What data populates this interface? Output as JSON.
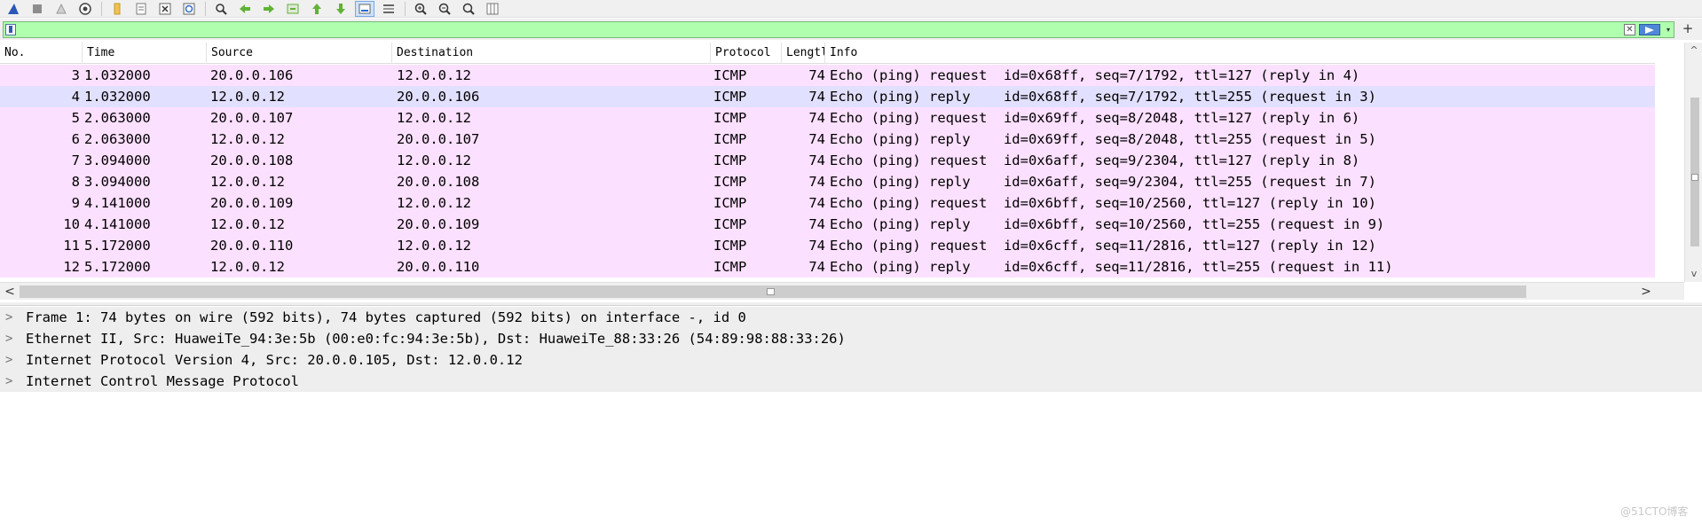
{
  "toolbar": {
    "icons": [
      "shark-fin-start-icon",
      "stop-capture-icon",
      "restart-capture-icon",
      "capture-options-icon",
      "open-file-icon",
      "save-file-icon",
      "close-file-icon",
      "reload-file-icon",
      "find-packet-icon",
      "go-back-icon",
      "go-forward-icon",
      "go-to-packet-icon",
      "first-packet-icon",
      "last-packet-icon",
      "autoscroll-icon",
      "colorize-icon",
      "zoom-in-icon",
      "zoom-out-icon",
      "normal-size-icon",
      "resize-columns-icon"
    ]
  },
  "filter": {
    "value": "",
    "clear_label": "✕",
    "dropdown_label": "▾",
    "add_label": "+",
    "bg_color": "#afffaf"
  },
  "packet_list": {
    "columns": [
      "No.",
      "Time",
      "Source",
      "Destination",
      "Protocol",
      "Lengtl",
      "Info"
    ],
    "rows": [
      {
        "no": "3",
        "time": "1.032000",
        "source": "20.0.0.106",
        "destination": "12.0.0.12",
        "protocol": "ICMP",
        "length": "74",
        "info": "Echo (ping) request  id=0x68ff, seq=7/1792, ttl=127 (reply in 4)"
      },
      {
        "no": "4",
        "time": "1.032000",
        "source": "12.0.0.12",
        "destination": "20.0.0.106",
        "protocol": "ICMP",
        "length": "74",
        "info": "Echo (ping) reply    id=0x68ff, seq=7/1792, ttl=255 (request in 3)"
      },
      {
        "no": "5",
        "time": "2.063000",
        "source": "20.0.0.107",
        "destination": "12.0.0.12",
        "protocol": "ICMP",
        "length": "74",
        "info": "Echo (ping) request  id=0x69ff, seq=8/2048, ttl=127 (reply in 6)"
      },
      {
        "no": "6",
        "time": "2.063000",
        "source": "12.0.0.12",
        "destination": "20.0.0.107",
        "protocol": "ICMP",
        "length": "74",
        "info": "Echo (ping) reply    id=0x69ff, seq=8/2048, ttl=255 (request in 5)"
      },
      {
        "no": "7",
        "time": "3.094000",
        "source": "20.0.0.108",
        "destination": "12.0.0.12",
        "protocol": "ICMP",
        "length": "74",
        "info": "Echo (ping) request  id=0x6aff, seq=9/2304, ttl=127 (reply in 8)"
      },
      {
        "no": "8",
        "time": "3.094000",
        "source": "12.0.0.12",
        "destination": "20.0.0.108",
        "protocol": "ICMP",
        "length": "74",
        "info": "Echo (ping) reply    id=0x6aff, seq=9/2304, ttl=255 (request in 7)"
      },
      {
        "no": "9",
        "time": "4.141000",
        "source": "20.0.0.109",
        "destination": "12.0.0.12",
        "protocol": "ICMP",
        "length": "74",
        "info": "Echo (ping) request  id=0x6bff, seq=10/2560, ttl=127 (reply in 10)"
      },
      {
        "no": "10",
        "time": "4.141000",
        "source": "12.0.0.12",
        "destination": "20.0.0.109",
        "protocol": "ICMP",
        "length": "74",
        "info": "Echo (ping) reply    id=0x6bff, seq=10/2560, ttl=255 (request in 9)"
      },
      {
        "no": "11",
        "time": "5.172000",
        "source": "20.0.0.110",
        "destination": "12.0.0.12",
        "protocol": "ICMP",
        "length": "74",
        "info": "Echo (ping) request  id=0x6cff, seq=11/2816, ttl=127 (reply in 12)"
      },
      {
        "no": "12",
        "time": "5.172000",
        "source": "12.0.0.12",
        "destination": "20.0.0.110",
        "protocol": "ICMP",
        "length": "74",
        "info": "Echo (ping) reply    id=0x6cff, seq=11/2816, ttl=255 (request in 11)"
      }
    ],
    "selected_index": 1,
    "row_color": "#fce0ff",
    "selected_color": "#e2e0ff"
  },
  "scroll": {
    "left_arrow": "<",
    "right_arrow": ">",
    "up_arrow": "^",
    "down_arrow": "v"
  },
  "details": {
    "chevron": ">",
    "items": [
      "Frame 1: 74 bytes on wire (592 bits), 74 bytes captured (592 bits) on interface -, id 0",
      "Ethernet II, Src: HuaweiTe_94:3e:5b (00:e0:fc:94:3e:5b), Dst: HuaweiTe_88:33:26 (54:89:98:88:33:26)",
      "Internet Protocol Version 4, Src: 20.0.0.105, Dst: 12.0.0.12",
      "Internet Control Message Protocol"
    ]
  },
  "watermark": "@51CTO博客"
}
